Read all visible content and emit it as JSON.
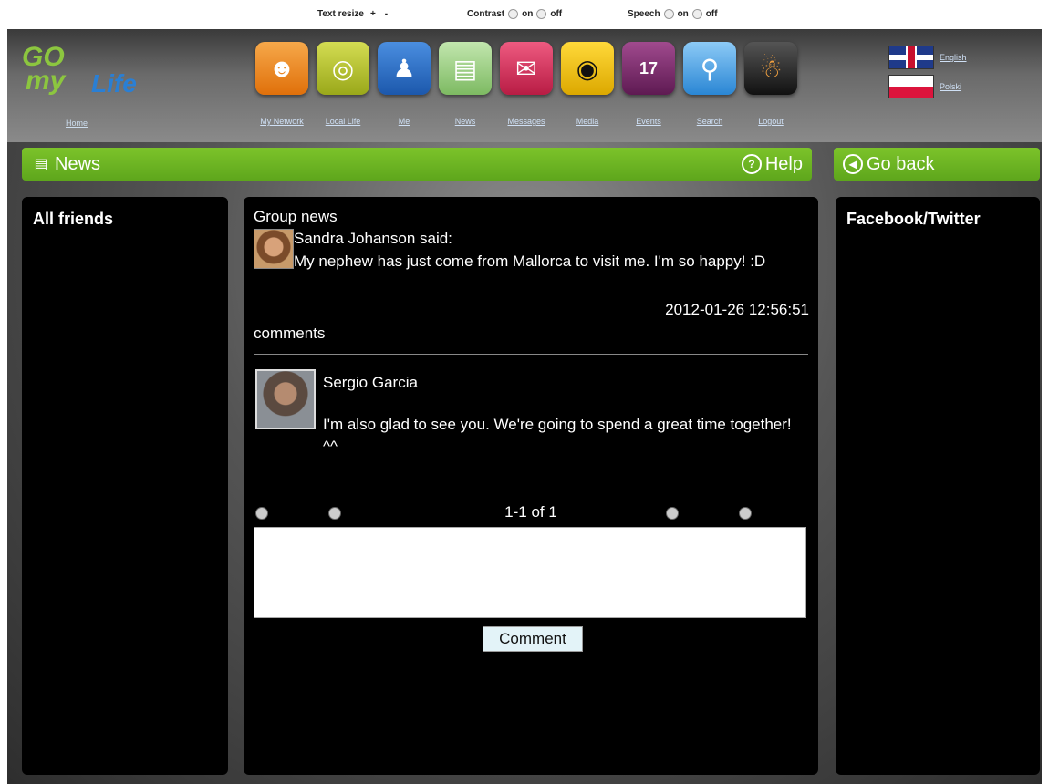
{
  "a11y": {
    "text_resize_label": "Text resize",
    "increase": "+",
    "decrease": "-",
    "contrast_label": "Contrast",
    "contrast_on": "on",
    "contrast_off": "off",
    "speech_label": "Speech",
    "speech_on": "on",
    "speech_off": "off"
  },
  "header": {
    "logo_go": "GO",
    "logo_my": "my",
    "logo_life": "Life",
    "home_label": "Home",
    "nav": [
      {
        "label": "My Network",
        "icon": "network-icon",
        "color": "#f08a1c"
      },
      {
        "label": "Local Life",
        "icon": "local-life-icon",
        "color": "#b9c22c"
      },
      {
        "label": "Me",
        "icon": "me-icon",
        "color": "#2c6fc4"
      },
      {
        "label": "News",
        "icon": "news-icon",
        "color": "#9fcf8a"
      },
      {
        "label": "Messages",
        "icon": "messages-icon",
        "color": "#d8345a"
      },
      {
        "label": "Media",
        "icon": "media-icon",
        "color": "#f2c200"
      },
      {
        "label": "Events",
        "icon": "events-icon",
        "color": "#7a2a6a"
      },
      {
        "label": "Search",
        "icon": "search-icon",
        "color": "#4aa3e8"
      },
      {
        "label": "Logout",
        "icon": "logout-icon",
        "color": "#333333"
      }
    ],
    "languages": [
      {
        "label": "English"
      },
      {
        "label": "Polski"
      }
    ]
  },
  "bars": {
    "news_title": "News",
    "help_label": "Help",
    "back_label": "Go back",
    "accent_color": "#6bb323"
  },
  "left_panel": {
    "title": "All friends"
  },
  "right_panel": {
    "title": "Facebook/Twitter"
  },
  "feed": {
    "group_label": "Group news",
    "post": {
      "author_line": "Sandra Johanson said:",
      "text": "My nephew has just come from Mallorca to visit me. I'm so happy! :D",
      "timestamp": "2012-01-26 12:56:51"
    },
    "comments_label": "comments",
    "comments": [
      {
        "author": "Sergio Garcia",
        "text": "I'm also glad to see you. We're going to spend a great time together! ^^"
      }
    ],
    "pager_text": "1-1 of 1",
    "comment_placeholder": "",
    "comment_button": "Comment"
  }
}
